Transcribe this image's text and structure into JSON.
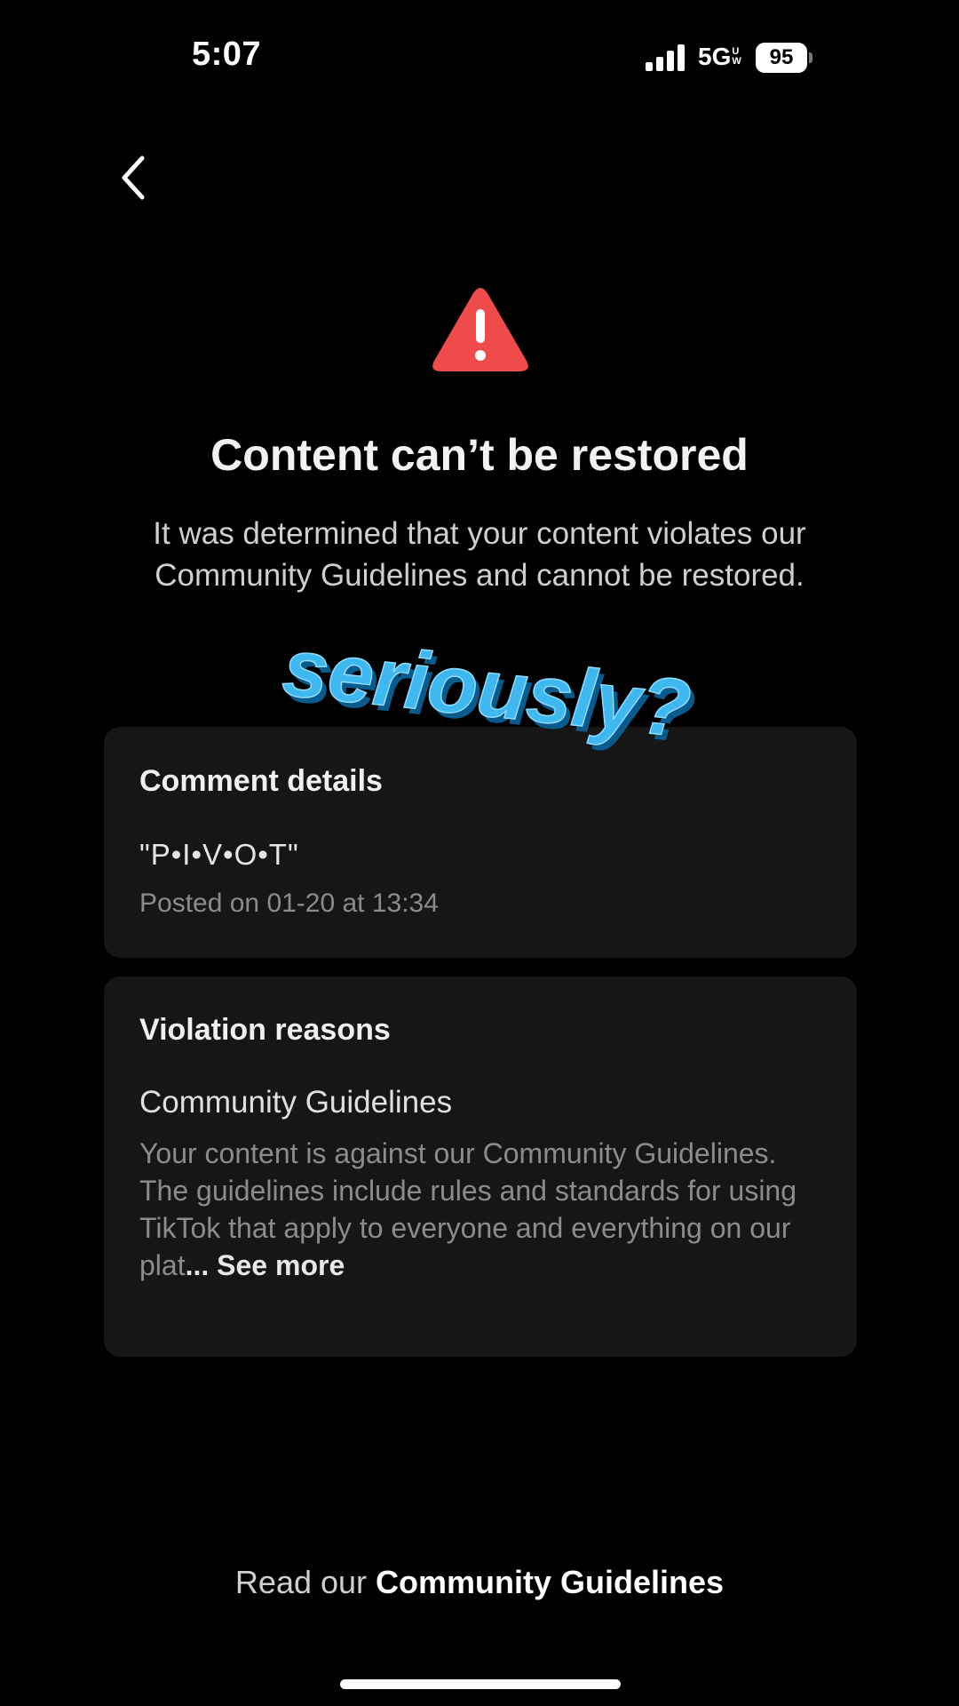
{
  "status_bar": {
    "time": "5:07",
    "network": "5G",
    "network_badge_top": "U",
    "network_badge_bottom": "W",
    "battery": "95"
  },
  "header": {
    "back_icon": "chevron-left-icon"
  },
  "alert": {
    "icon": "warning-triangle-icon",
    "icon_color": "#ef4b4b",
    "title": "Content can’t be restored",
    "description": "It was determined that your content violates our Community Guidelines and cannot be restored."
  },
  "sticker": {
    "text": "seriously?",
    "color": "#3fb8f0"
  },
  "comment_card": {
    "title": "Comment details",
    "comment": "\"P•I•V•O•T\"",
    "posted": "Posted on 01-20 at 13:34"
  },
  "violation_card": {
    "title": "Violation reasons",
    "reason_title": "Community Guidelines",
    "reason_text": "Your content is against our Community Guidelines. The guidelines include rules and standards for using TikTok that apply to everyone and everything on our plat",
    "see_more": "... See more"
  },
  "footer": {
    "prefix": "Read our ",
    "link": "Community Guidelines"
  }
}
